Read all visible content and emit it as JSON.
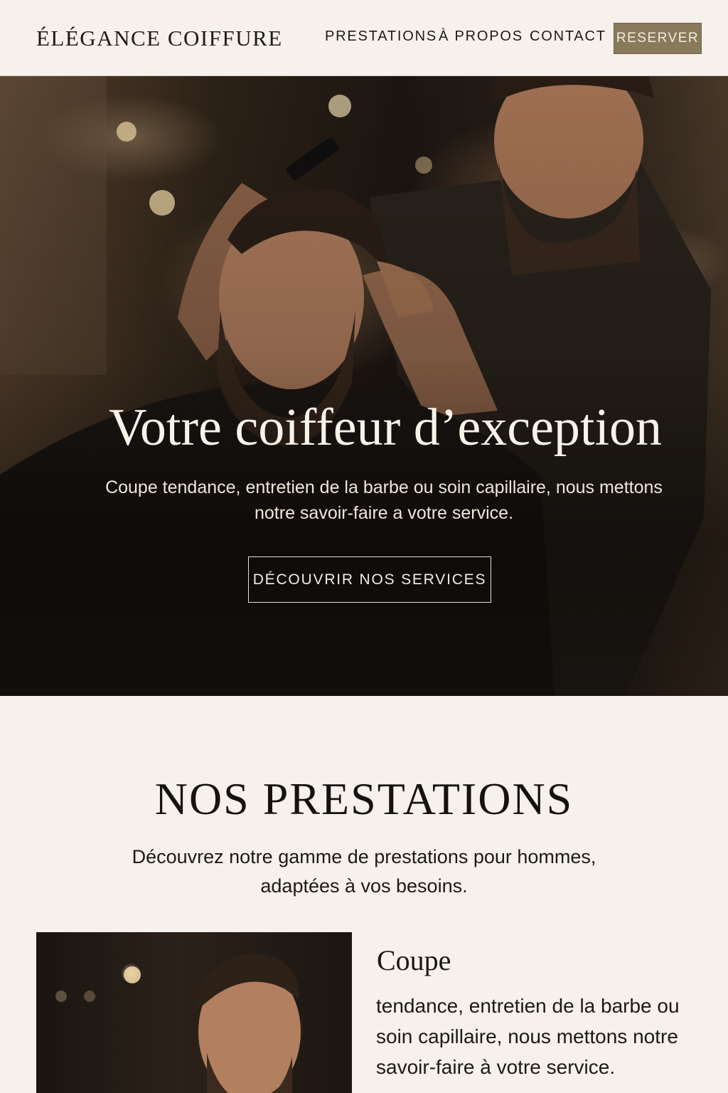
{
  "header": {
    "logo": "ÉLÉGANCE COIFFURE",
    "nav": [
      "PRESTATIONS",
      "À PROPOS",
      "CONTACT"
    ],
    "cta": "RESERVER"
  },
  "hero": {
    "title": "Votre coiffeur d’exception",
    "subtitle": "Coupe tendance, entretien de la barbe ou soin capillaire, nous mettons notre savoir-faire a votre service.",
    "cta": "DÉCOUVRIR NOS SERVICES"
  },
  "services": {
    "title": "NOS PRESTATIONS",
    "subtitle": "Découvrez notre gamme de prestations pour hommes, adaptées à vos besoins.",
    "cards": [
      {
        "title": "Coupe",
        "text": "tendance, entretien de la barbe ou soin capillaire, nous mettons notre savoir-faire à votre service."
      }
    ]
  },
  "colors": {
    "background": "#f6f1ec",
    "accent": "#8a7a5c",
    "text": "#1c1814"
  }
}
